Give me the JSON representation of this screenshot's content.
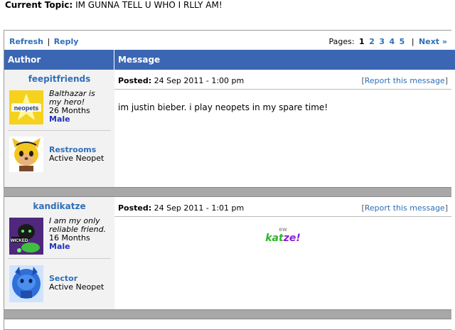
{
  "topic": {
    "label": "Current Topic:",
    "title": "IM GUNNA TELL U WHO I RLLY AM!"
  },
  "nav": {
    "refresh": "Refresh",
    "separator": "|",
    "reply": "Reply",
    "pages_label": "Pages:",
    "current_page": "1",
    "pages": [
      "2",
      "3",
      "4",
      "5"
    ],
    "next_sep": "|",
    "next": "Next »"
  },
  "columns": {
    "author": "Author",
    "message": "Message"
  },
  "posts": [
    {
      "username": "feepitfriends",
      "quote": "Balthazar is my hero!",
      "months": "26 Months",
      "gender": "Male",
      "pet_name": "Restrooms",
      "pet_status": "Active Neopet",
      "posted_label": "Posted:",
      "posted_time": "24 Sep 2011 - 1:00 pm",
      "report": "Report this message",
      "message": "im justin bieber. i play neopets in my spare time!"
    },
    {
      "username": "kandikatze",
      "quote": "I am my only reliable friend.",
      "months": "16 Months",
      "gender": "Male",
      "pet_name": "Sector",
      "pet_status": "Active Neopet",
      "posted_label": "Posted:",
      "posted_time": "24 Sep 2011 - 1:01 pm",
      "report": "Report this message",
      "signature_small": "ew",
      "signature_big": "katze!"
    }
  ],
  "brackets": {
    "open": "[",
    "close": "]"
  },
  "avatar_text": {
    "neopets": "neopets",
    "wicked": "WICKED"
  }
}
